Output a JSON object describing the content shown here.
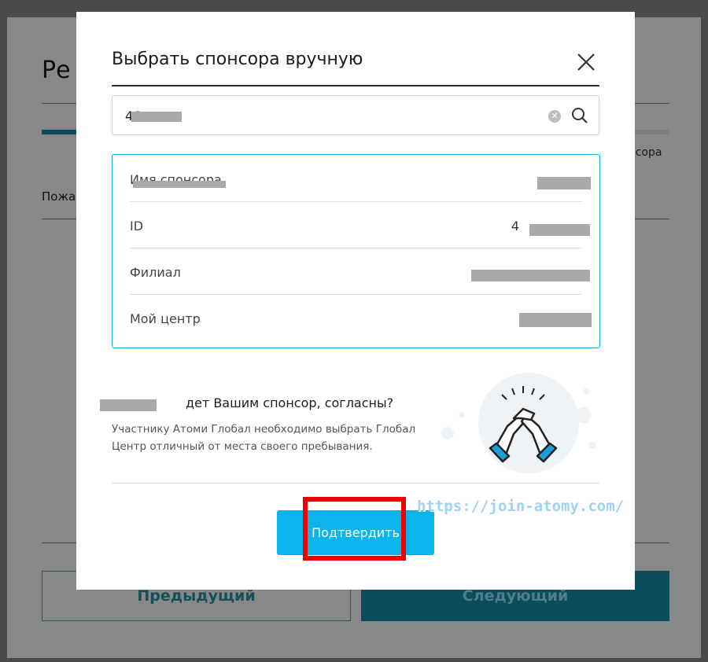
{
  "background": {
    "title": "Ре",
    "step_label": "онсора",
    "please_text": "Пожа",
    "prev_button": "Предыдущий",
    "next_button": "Следующий"
  },
  "modal": {
    "title": "Выбрать спонсора вручную",
    "search": {
      "value": "46",
      "placeholder": ""
    },
    "info_rows": [
      {
        "label": "Имя спонсора",
        "value": ""
      },
      {
        "label": "ID",
        "value": "4"
      },
      {
        "label": "Филиал",
        "value": ""
      },
      {
        "label": "Мой центр",
        "value": ""
      }
    ],
    "confirm_question": "дет Вашим спонсор, согласны?",
    "confirm_note": "Участнику Атоми Глобал необходимо выбрать Глобал Центр отличный от места своего пребывания.",
    "confirm_button": "Подтвердить",
    "icons": [
      "close-icon",
      "clear-icon",
      "search-icon",
      "handshake-icon"
    ]
  },
  "watermark": "https://join-atomy.com/",
  "colors": {
    "accent": "#0bb4ea",
    "info_border": "#1aa9d6",
    "highlight": "#ee0000",
    "next_button_bg": "#0b4d5c"
  }
}
